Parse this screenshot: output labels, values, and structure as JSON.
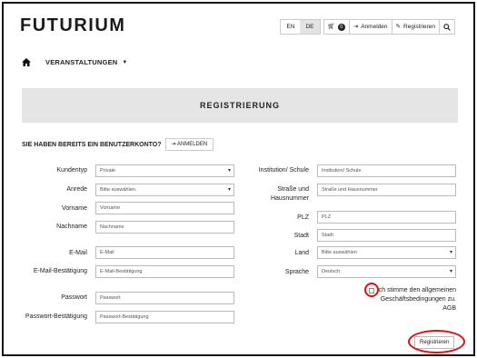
{
  "header": {
    "logo": "FUTURIUM",
    "lang": [
      "EN",
      "DE"
    ],
    "cart_count": "0",
    "login_label": "Anmelden",
    "register_label": "Registrieren"
  },
  "nav": {
    "menu_label": "VERANSTALTUNGEN"
  },
  "banner": {
    "title": "REGISTRIERUNG"
  },
  "account": {
    "question": "SIE HABEN BEREITS EIN BENUTZERKONTO?",
    "login_button": "ANMELDEN"
  },
  "form": {
    "left": [
      {
        "label": "Kundentyp",
        "value": "Private",
        "type": "select"
      },
      {
        "label": "Anrede",
        "value": "Bitte auswählen.",
        "type": "select"
      },
      {
        "label": "Vorname",
        "value": "Vorname",
        "type": "input"
      },
      {
        "label": "Nachname",
        "value": "Nachname",
        "type": "input"
      },
      {
        "label": "E-Mail",
        "value": "E-Mail",
        "type": "input"
      },
      {
        "label": "E-Mail-Bestätigung",
        "value": "E-Mail-Bestätigung",
        "type": "input"
      },
      {
        "label": "Passwort",
        "value": "Passwort",
        "type": "input"
      },
      {
        "label": "Passwort-Bestätigung",
        "value": "Passwort-Bestätigung",
        "type": "input"
      }
    ],
    "right": [
      {
        "label": "Institution/ Schule",
        "value": "Institution/ Schule",
        "type": "input"
      },
      {
        "label": "Straße und Hausnummer",
        "value": "Straße und Hausnummer",
        "type": "input"
      },
      {
        "label": "PLZ",
        "value": "PLZ",
        "type": "input"
      },
      {
        "label": "Stadt",
        "value": "Stadt",
        "type": "input"
      },
      {
        "label": "Land",
        "value": "Bitte auswählen",
        "type": "select"
      },
      {
        "label": "Sprache",
        "value": "Deutsch",
        "type": "select"
      }
    ],
    "agb_text": "Ich stimme den allgemeinen Geschäftsbedingungen zu. AGB",
    "submit_label": "Registrieren"
  },
  "colors": {
    "highlight": "#dd1111",
    "banner_bg": "#e5e5e5"
  }
}
